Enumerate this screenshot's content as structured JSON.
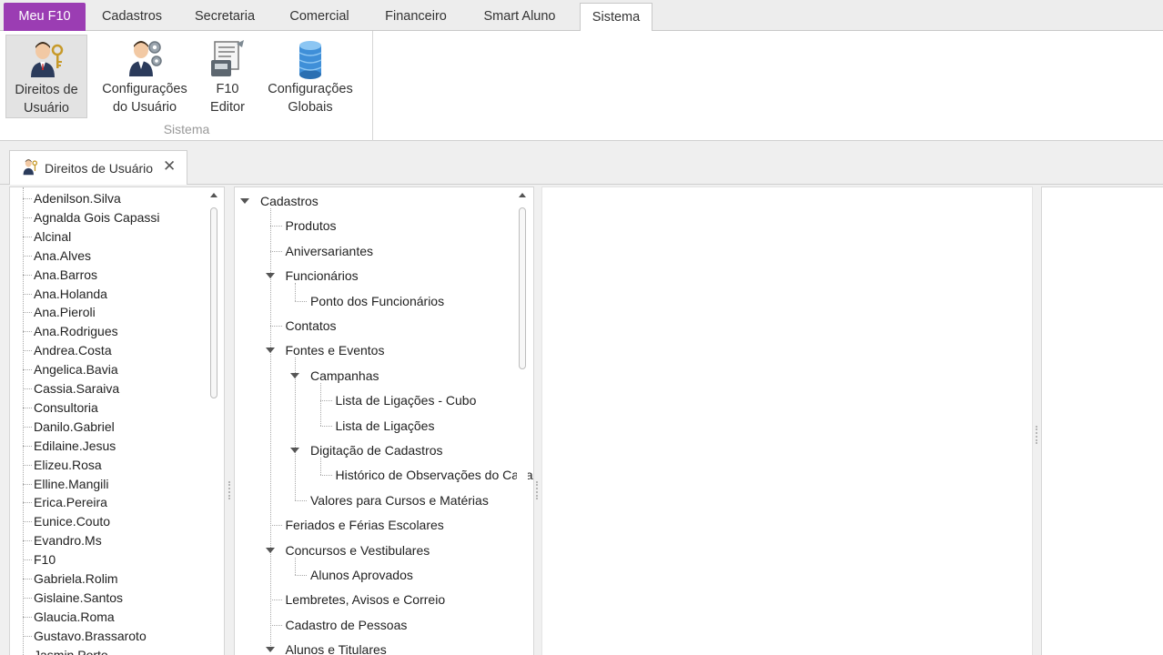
{
  "ribbon": {
    "tabs": [
      {
        "label": "Meu F10"
      },
      {
        "label": "Cadastros"
      },
      {
        "label": "Secretaria"
      },
      {
        "label": "Comercial"
      },
      {
        "label": "Financeiro"
      },
      {
        "label": "Smart Aluno"
      },
      {
        "label": "Sistema"
      }
    ],
    "active_tab": "Sistema",
    "group_label": "Sistema",
    "buttons": [
      {
        "line1": "Direitos de",
        "line2": "Usuário",
        "icon": "user-key-icon"
      },
      {
        "line1": "Configurações",
        "line2": "do Usuário",
        "icon": "user-gears-icon"
      },
      {
        "line1": "F10",
        "line2": "Editor",
        "icon": "editor-icon"
      },
      {
        "line1": "Configurações",
        "line2": "Globais",
        "icon": "database-icon"
      }
    ]
  },
  "document_tab": {
    "label": "Direitos de Usuário",
    "icon": "user-key-icon",
    "close_icon": "close-icon"
  },
  "users": [
    "Adenilson.Silva",
    "Agnalda Gois Capassi",
    "Alcinal",
    "Ana.Alves",
    "Ana.Barros",
    "Ana.Holanda",
    "Ana.Pieroli",
    "Ana.Rodrigues",
    "Andrea.Costa",
    "Angelica.Bavia",
    "Cassia.Saraiva",
    "Consultoria",
    "Danilo.Gabriel",
    "Edilaine.Jesus",
    "Elizeu.Rosa",
    "Elline.Mangili",
    "Erica.Pereira",
    "Eunice.Couto",
    "Evandro.Ms",
    "F10",
    "Gabriela.Rolim",
    "Gislaine.Santos",
    "Glaucia.Roma",
    "Gustavo.Brassaroto",
    "Jasmin.Porto"
  ],
  "tree": [
    "Cadastros",
    "Produtos",
    "Aniversariantes",
    "Funcionários",
    "Ponto dos Funcionários",
    "Contatos",
    "Fontes e Eventos",
    "Campanhas",
    "Lista de Ligações - Cubo",
    "Lista de Ligações",
    "Digitação de Cadastros",
    "Histórico de Observações do Cadastro",
    "Valores para Cursos e Matérias",
    "Feriados e Férias Escolares",
    "Concursos e Vestibulares",
    "Alunos Aprovados",
    "Lembretes, Avisos e Correio",
    "Cadastro de Pessoas",
    "Alunos e Titulares"
  ],
  "colors": {
    "home_tab": "#9b3db3",
    "panel_bg": "#f0f0f0"
  }
}
